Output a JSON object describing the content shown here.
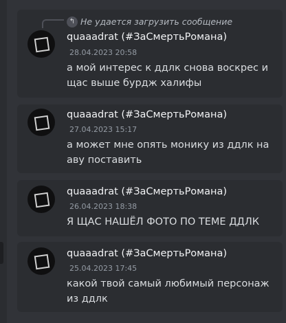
{
  "reply_preview": {
    "text": "Не удается загрузить сообщение",
    "icon": "reply-arrow-icon"
  },
  "messages": [
    {
      "username": "quaaadrat (#ЗаСмертьРомана)",
      "timestamp": "28.04.2023 20:58",
      "content": "а мой интерес к ддлк снова воскрес и щас выше бурдж халифы"
    },
    {
      "username": "quaaadrat (#ЗаСмертьРомана)",
      "timestamp": "27.04.2023 15:17",
      "content": "а может мне опять монику из ддлк на аву поставить"
    },
    {
      "username": "quaaadrat (#ЗаСмертьРомана)",
      "timestamp": "26.04.2023 18:38",
      "content": "Я ЩАС НАШЁЛ ФОТО ПО ТЕМЕ ДДЛК"
    },
    {
      "username": "quaaadrat (#ЗаСмертьРомана)",
      "timestamp": "25.04.2023 17:45",
      "content": "какой твой самый любимый персонаж из ддлк"
    }
  ],
  "colors": {
    "background": "#313338",
    "card": "#2b2d31",
    "text": "#dbdee1",
    "muted": "#949ba4"
  }
}
